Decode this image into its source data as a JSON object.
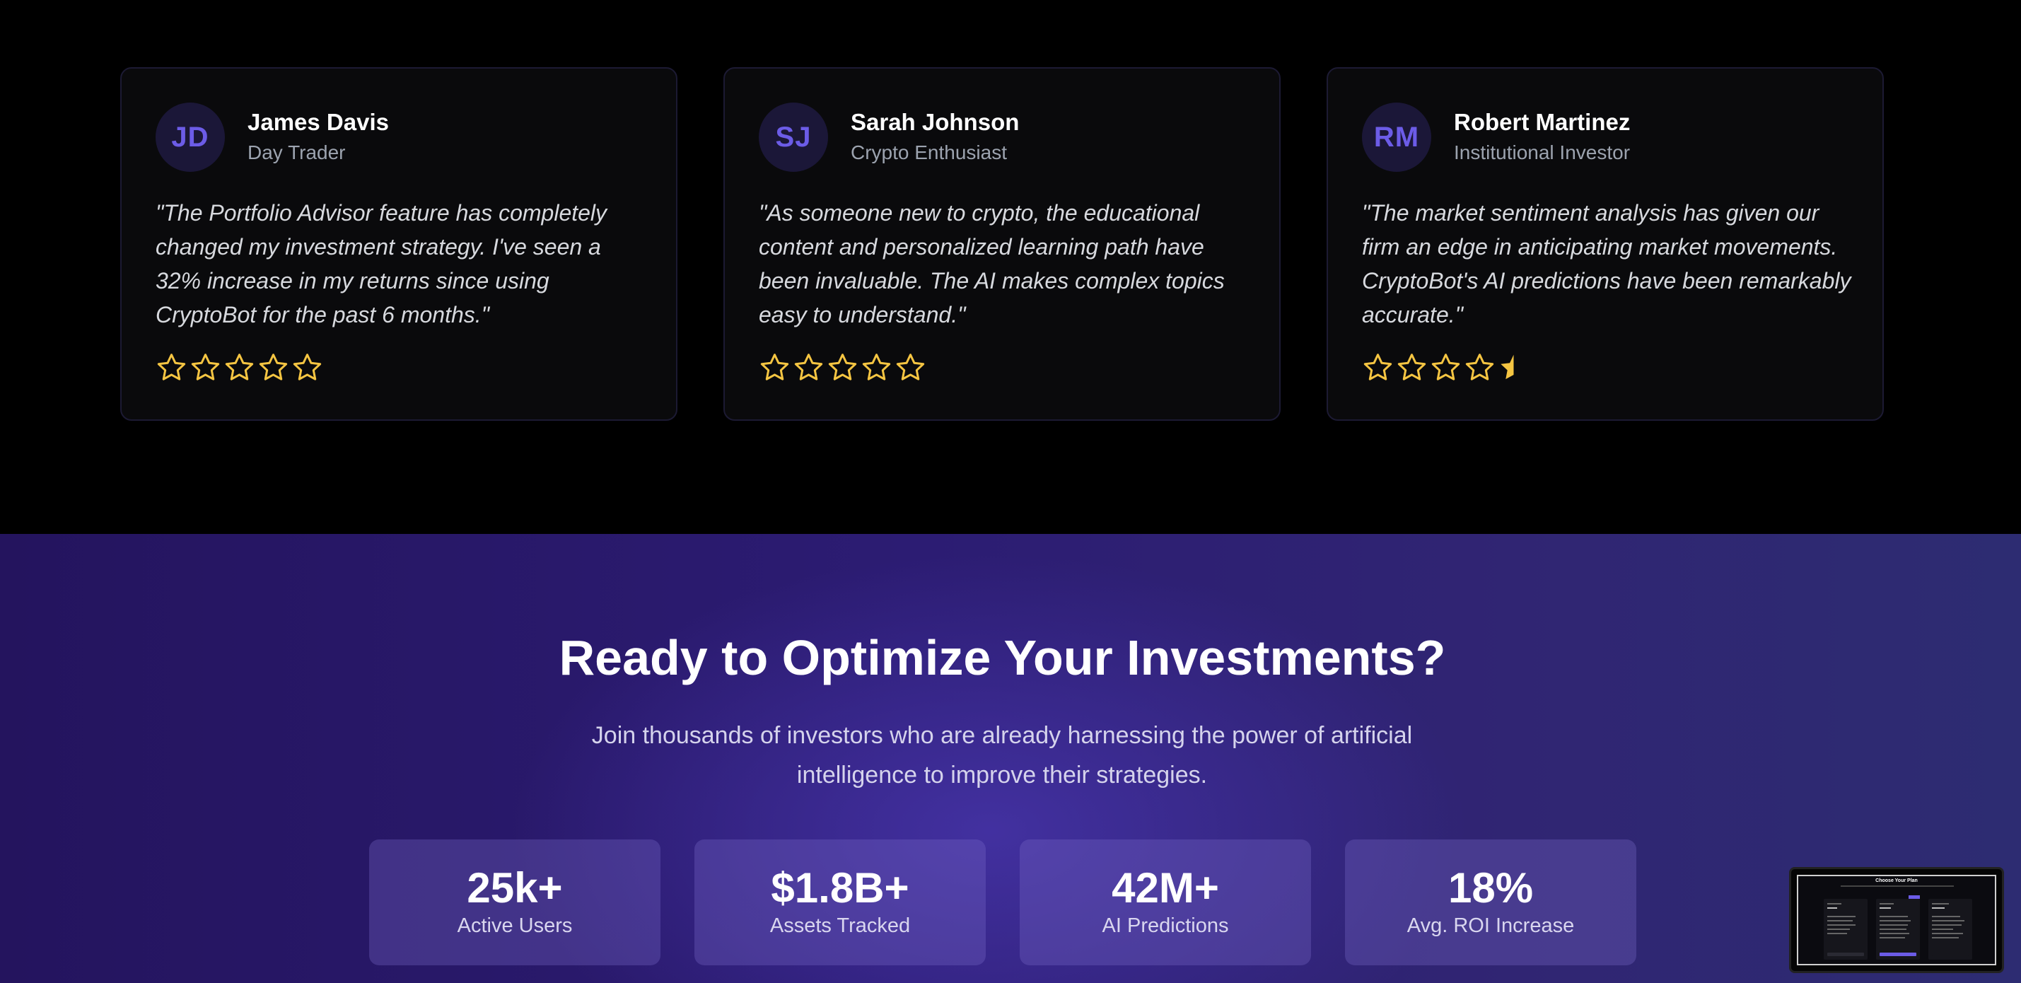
{
  "testimonials": [
    {
      "initials": "JD",
      "name": "James Davis",
      "role": "Day Trader",
      "quote": "\"The Portfolio Advisor feature has completely changed my investment strategy. I've seen a 32% increase in my returns since using CryptoBot for the past 6 months.\"",
      "rating": 5
    },
    {
      "initials": "SJ",
      "name": "Sarah Johnson",
      "role": "Crypto Enthusiast",
      "quote": "\"As someone new to crypto, the educational content and personalized learning path have been invaluable. The AI makes complex topics easy to understand.\"",
      "rating": 5
    },
    {
      "initials": "RM",
      "name": "Robert Martinez",
      "role": "Institutional Investor",
      "quote": "\"The market sentiment analysis has given our firm an edge in anticipating market movements. CryptoBot's AI predictions have been remarkably accurate.\"",
      "rating": 4.5
    }
  ],
  "cta": {
    "title": "Ready to Optimize Your Investments?",
    "subtitle": "Join thousands of investors who are already harnessing the power of artificial intelligence to improve their strategies.",
    "stats": [
      {
        "value": "25k+",
        "label": "Active Users"
      },
      {
        "value": "$1.8B+",
        "label": "Assets Tracked"
      },
      {
        "value": "42M+",
        "label": "AI Predictions"
      },
      {
        "value": "18%",
        "label": "Avg. ROI Increase"
      }
    ]
  },
  "preview_thumbnail": {
    "title": "Choose Your Plan"
  },
  "colors": {
    "accent": "#6c5ce7",
    "star": "#f5c542",
    "card_bg": "#0a0a0c",
    "cta_bg": "#2c1c73"
  },
  "icons": [
    "star-icon",
    "half-star-icon"
  ]
}
